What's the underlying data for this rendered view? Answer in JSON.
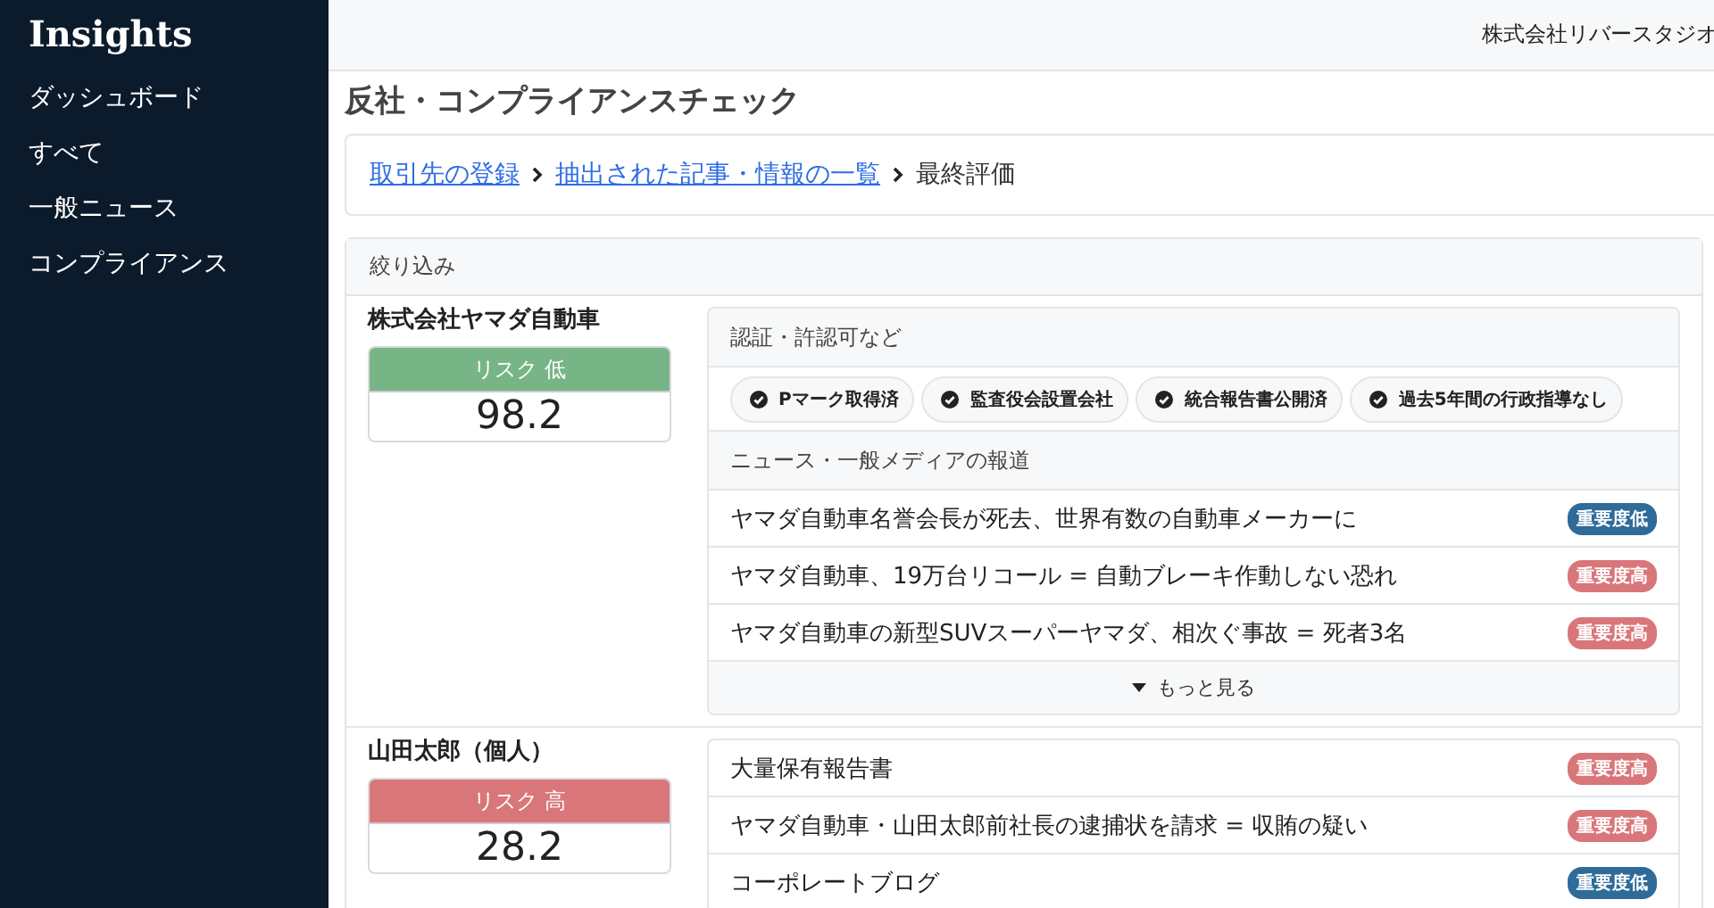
{
  "sidebar": {
    "brand": "Insights",
    "items": [
      {
        "label": "ダッシュボード"
      },
      {
        "label": "すべて"
      },
      {
        "label": "一般ニュース"
      },
      {
        "label": "コンプライアンス"
      }
    ]
  },
  "header": {
    "company": "株式会社リバースタジオ"
  },
  "page_title": "反社・コンプライアンスチェック",
  "breadcrumb": [
    {
      "label": "取引先の登録",
      "kind": "link"
    },
    {
      "label": "抽出された記事・情報の一覧",
      "kind": "link"
    },
    {
      "label": "最終評価",
      "kind": "current"
    }
  ],
  "filter": {
    "title": "絞り込み",
    "entities": [
      {
        "name": "株式会社ヤマダ自動車",
        "risk": {
          "label": "リスク 低",
          "score": "98.2",
          "kind": "low"
        },
        "sections": [
          {
            "title": "認証・許認可など",
            "kind": "tags",
            "items": [
              {
                "label": "Pマーク取得済"
              },
              {
                "label": "監査役会設置会社"
              },
              {
                "label": "統合報告書公開済"
              },
              {
                "label": "過去5年間の行政指導なし"
              }
            ]
          },
          {
            "title": "ニュース・一般メディアの報道",
            "kind": "news",
            "items": [
              {
                "title": "ヤマダ自動車名誉会長が死去、世界有数の自動車メーカーに",
                "badge": "重要度低",
                "kind": "low"
              },
              {
                "title": "ヤマダ自動車、19万台リコール = 自動ブレーキ作動しない恐れ",
                "badge": "重要度高",
                "kind": "high"
              },
              {
                "title": "ヤマダ自動車の新型SUVスーパーヤマダ、相次ぐ事故 = 死者3名",
                "badge": "重要度高",
                "kind": "high"
              }
            ],
            "more": "もっと見る"
          }
        ]
      },
      {
        "name": "山田太郎（個人）",
        "risk": {
          "label": "リスク 高",
          "score": "28.2",
          "kind": "high"
        },
        "sections": [
          {
            "kind": "news",
            "items": [
              {
                "title": "大量保有報告書",
                "badge": "重要度高",
                "kind": "high"
              },
              {
                "title": "ヤマダ自動車・山田太郎前社長の逮捕状を請求 = 収賄の疑い",
                "badge": "重要度高",
                "kind": "high"
              },
              {
                "title": "コーポレートブログ",
                "badge": "重要度低",
                "kind": "low"
              }
            ]
          }
        ]
      }
    ]
  }
}
